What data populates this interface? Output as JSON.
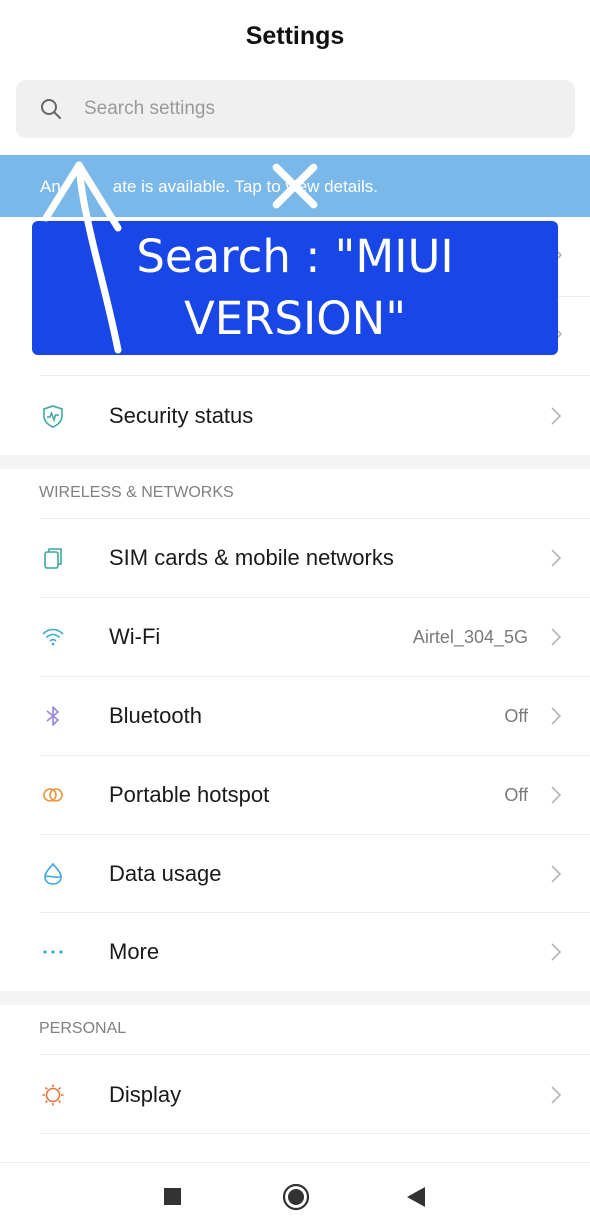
{
  "header": {
    "title": "Settings"
  },
  "search": {
    "placeholder": "Search settings",
    "icon": "search-icon"
  },
  "banner": {
    "text": "An update is available. Tap to view details.",
    "visible_text": "ate is available. Tap to view details."
  },
  "annotation": {
    "text": "Search : \"MIUI\nVERSION\"",
    "color": "#1946e6"
  },
  "rows_top": [
    {
      "label": "Security status",
      "icon": "shield-icon"
    }
  ],
  "sections": {
    "wireless": "WIRELESS & NETWORKS",
    "personal": "PERSONAL"
  },
  "wireless_items": [
    {
      "label": "SIM cards & mobile networks",
      "value": "",
      "icon": "sim-icon"
    },
    {
      "label": "Wi-Fi",
      "value": "Airtel_304_5G",
      "icon": "wifi-icon"
    },
    {
      "label": "Bluetooth",
      "value": "Off",
      "icon": "bluetooth-icon"
    },
    {
      "label": "Portable hotspot",
      "value": "Off",
      "icon": "hotspot-icon"
    },
    {
      "label": "Data usage",
      "value": "",
      "icon": "data-usage-icon"
    },
    {
      "label": "More",
      "value": "",
      "icon": "more-icon"
    }
  ],
  "personal_items": [
    {
      "label": "Display",
      "value": "",
      "icon": "display-icon"
    }
  ],
  "colors": {
    "banner": "#7ab8ea",
    "accent_teal": "#3aa8a0",
    "bluetooth": "#9b87d8",
    "hotspot": "#e9953b",
    "display": "#e9763b"
  }
}
